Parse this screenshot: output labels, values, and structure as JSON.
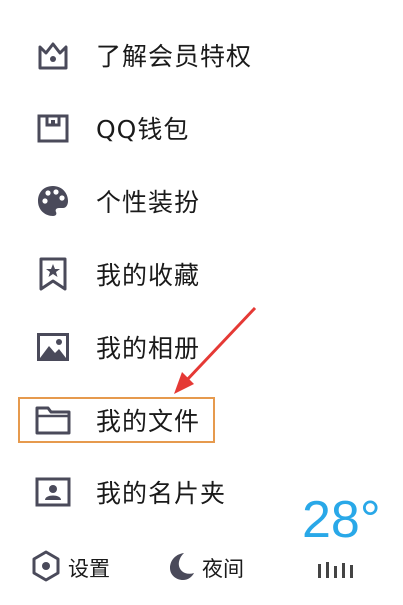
{
  "menu": {
    "items": [
      {
        "label": "了解会员特权",
        "icon": "crown-icon"
      },
      {
        "label": "QQ钱包",
        "icon": "wallet-icon"
      },
      {
        "label": "个性装扮",
        "icon": "palette-icon"
      },
      {
        "label": "我的收藏",
        "icon": "bookmark-star-icon"
      },
      {
        "label": "我的相册",
        "icon": "image-icon"
      },
      {
        "label": "我的文件",
        "icon": "folder-icon"
      },
      {
        "label": "我的名片夹",
        "icon": "contact-card-icon"
      }
    ]
  },
  "bottom": {
    "settings_label": "设置",
    "night_label": "夜间"
  },
  "weather": {
    "temperature": "28°"
  },
  "colors": {
    "icon": "#4a4a5a",
    "highlight": "#e69a4e",
    "arrow": "#e53935",
    "weather": "#29a8e8"
  }
}
